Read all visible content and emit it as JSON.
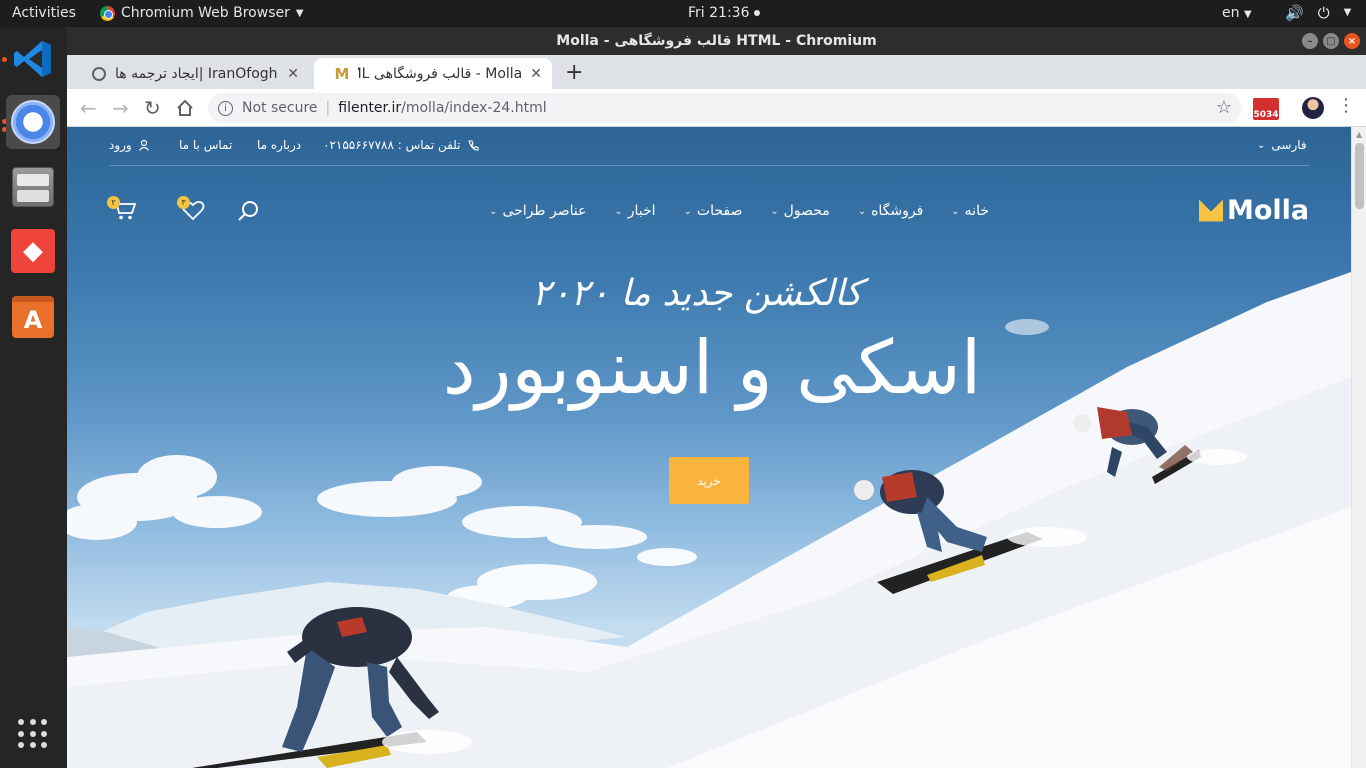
{
  "os": {
    "activities": "Activities",
    "app_menu": "Chromium Web Browser",
    "clock": "Fri 21:36",
    "language": "en"
  },
  "window": {
    "title": "Molla - قالب فروشگاهی HTML - Chromium"
  },
  "tabs": [
    {
      "label": "IranOfogh |ایجاد ترجمه ها",
      "active": false
    },
    {
      "label": "Molla - قالب فروشگاهی HTML",
      "active": true
    }
  ],
  "toolbar": {
    "security": "Not secure",
    "url_host": "filenter.ir",
    "url_path": "/molla/index-24.html",
    "ext_badge": "5034"
  },
  "site": {
    "topbar": {
      "login": "ورود",
      "contact": "تماس با ما",
      "about": "درباره ما",
      "phone": "تلفن تماس : ۰۲۱۵۵۶۶۷۷۸۸",
      "language": "فارسی"
    },
    "logo": "Molla",
    "nav": [
      "خانه",
      "فروشگاه",
      "محصول",
      "صفحات",
      "اخبار",
      "عناصر طراحی"
    ],
    "wishlist_count": "۳",
    "cart_count": "۲",
    "hero": {
      "subtitle": "کالکشن جدید ما ۲۰۲۰",
      "title": "اسکی و اسنوبورد",
      "button": "خرید"
    }
  }
}
